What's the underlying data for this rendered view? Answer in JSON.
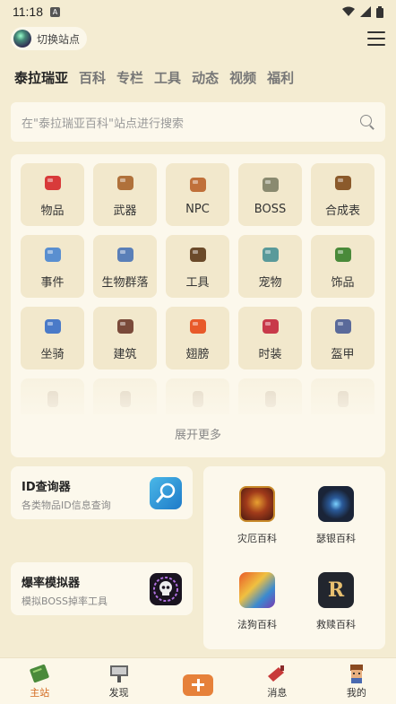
{
  "status": {
    "time": "11:18",
    "box_glyph": "A"
  },
  "site_switch": {
    "label": "切换站点"
  },
  "tabs": [
    {
      "label": "泰拉瑞亚",
      "active": true
    },
    {
      "label": "百科"
    },
    {
      "label": "专栏"
    },
    {
      "label": "工具"
    },
    {
      "label": "动态"
    },
    {
      "label": "视频"
    },
    {
      "label": "福利"
    }
  ],
  "search": {
    "placeholder": "在\"泰拉瑞亚百科\"站点进行搜索"
  },
  "categories": [
    {
      "label": "物品",
      "icon": "potion-icon",
      "color": "#d83a3a"
    },
    {
      "label": "武器",
      "icon": "sword-icon",
      "color": "#b0713b"
    },
    {
      "label": "NPC",
      "icon": "npc-icon",
      "color": "#c0703a"
    },
    {
      "label": "BOSS",
      "icon": "skull-icon",
      "color": "#8a8a70"
    },
    {
      "label": "合成表",
      "icon": "workbench-icon",
      "color": "#8b5a2b"
    },
    {
      "label": "事件",
      "icon": "event-icon",
      "color": "#5a8fd0"
    },
    {
      "label": "生物群落",
      "icon": "biome-icon",
      "color": "#5a7fb8"
    },
    {
      "label": "工具",
      "icon": "pickaxe-icon",
      "color": "#6b4a2a"
    },
    {
      "label": "宠物",
      "icon": "pet-icon",
      "color": "#5a9a9a"
    },
    {
      "label": "饰品",
      "icon": "boots-icon",
      "color": "#4a8a3a"
    },
    {
      "label": "坐骑",
      "icon": "mount-icon",
      "color": "#4a7ac8"
    },
    {
      "label": "建筑",
      "icon": "wood-icon",
      "color": "#7a4a3a"
    },
    {
      "label": "翅膀",
      "icon": "wings-icon",
      "color": "#e85a2a"
    },
    {
      "label": "时装",
      "icon": "vanity-icon",
      "color": "#c83a4a"
    },
    {
      "label": "盔甲",
      "icon": "armor-icon",
      "color": "#5a6a9a"
    }
  ],
  "faded_icons": [
    "torch-icon",
    "staff-icon",
    "mushroom-icon",
    "hook-icon",
    "bomb-icon"
  ],
  "expand_label": "展开更多",
  "tools": [
    {
      "title": "ID查询器",
      "desc": "各类物品ID信息查询",
      "icon": "magnifier-tool-icon"
    },
    {
      "title": "爆率模拟器",
      "desc": "模拟BOSS掉率工具",
      "icon": "skull-tool-icon"
    }
  ],
  "wikis": [
    {
      "label": "灾厄百科",
      "icon": "calamity-icon"
    },
    {
      "label": "瑟银百科",
      "icon": "thorium-icon"
    },
    {
      "label": "法狗百科",
      "icon": "fargo-icon"
    },
    {
      "label": "救赎百科",
      "icon": "redemption-icon"
    }
  ],
  "nav": [
    {
      "label": "主站",
      "active": true
    },
    {
      "label": "发现"
    },
    {
      "label": "",
      "plus": true
    },
    {
      "label": "消息"
    },
    {
      "label": "我的"
    }
  ],
  "colors": {
    "accent": "#e6813a",
    "background": "#f4ecd2",
    "card": "#fcf8ec"
  }
}
